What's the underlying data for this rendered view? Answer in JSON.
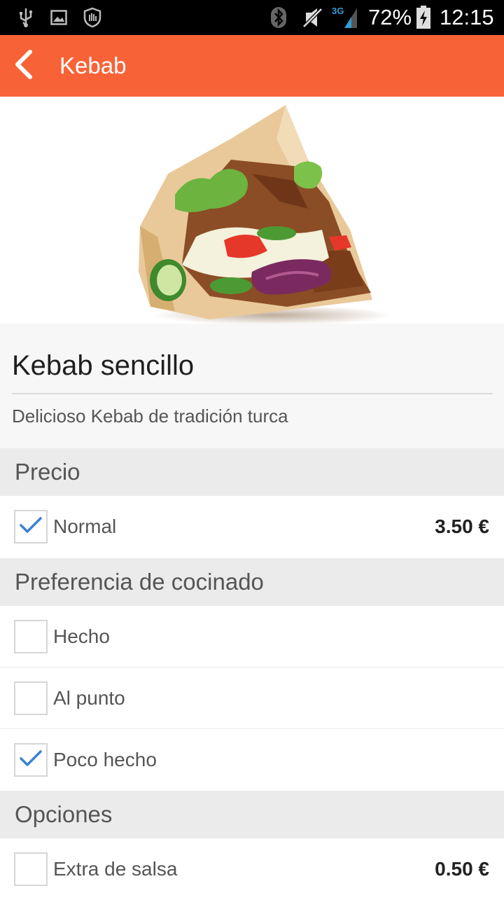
{
  "status_bar": {
    "battery_percent": "72%",
    "time": "12:15",
    "network_type": "3G",
    "icons": [
      "usb-icon",
      "image-icon",
      "shield-hand-icon",
      "bluetooth-icon",
      "vibrate-off-icon",
      "signal-icon",
      "battery-charging-icon"
    ]
  },
  "app_bar": {
    "title": "Kebab",
    "back_icon": "chevron-left-icon",
    "color": "#f76337"
  },
  "product": {
    "name": "Kebab sencillo",
    "description": "Delicioso Kebab de tradición turca"
  },
  "sections": {
    "price": {
      "title": "Precio",
      "options": [
        {
          "label": "Normal",
          "price": "3.50 €",
          "checked": true
        }
      ]
    },
    "cooking": {
      "title": "Preferencia de cocinado",
      "options": [
        {
          "label": "Hecho",
          "checked": false
        },
        {
          "label": "Al punto",
          "checked": false
        },
        {
          "label": "Poco hecho",
          "checked": true
        }
      ]
    },
    "extras": {
      "title": "Opciones",
      "options": [
        {
          "label": "Extra de salsa",
          "price": "0.50 €",
          "checked": false
        }
      ]
    }
  },
  "colors": {
    "accent": "#f76337",
    "check": "#3b82d1",
    "section_bg": "#ebebeb"
  }
}
